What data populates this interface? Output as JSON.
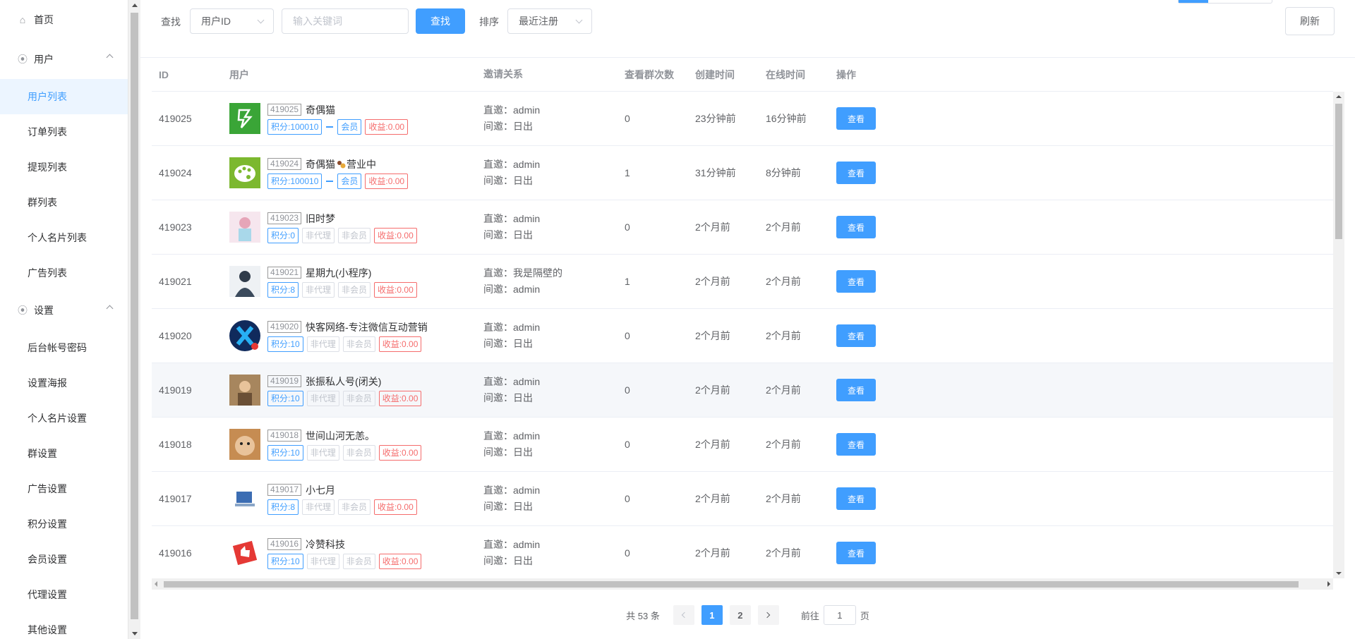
{
  "sidebar": {
    "home": {
      "label": "首页",
      "icon": "home-icon"
    },
    "groups": [
      {
        "label": "用户",
        "icon": "location-icon",
        "items": [
          {
            "label": "用户列表",
            "active": true
          },
          {
            "label": "订单列表"
          },
          {
            "label": "提现列表"
          },
          {
            "label": "群列表"
          },
          {
            "label": "个人名片列表"
          },
          {
            "label": "广告列表"
          }
        ]
      },
      {
        "label": "设置",
        "icon": "location-icon",
        "items": [
          {
            "label": "后台帐号密码"
          },
          {
            "label": "设置海报"
          },
          {
            "label": "个人名片设置"
          },
          {
            "label": "群设置"
          },
          {
            "label": "广告设置"
          },
          {
            "label": "积分设置"
          },
          {
            "label": "会员设置"
          },
          {
            "label": "代理设置"
          },
          {
            "label": "其他设置"
          }
        ]
      }
    ]
  },
  "toolbar": {
    "search_label": "查找",
    "field_select": "用户ID",
    "keyword_placeholder": "输入关键词",
    "search_button": "查找",
    "sort_label": "排序",
    "sort_select": "最近注册",
    "refresh_button": "刷新"
  },
  "table": {
    "headers": {
      "id": "ID",
      "user": "用户",
      "invite": "邀请关系",
      "views": "查看群次数",
      "created": "创建时间",
      "online": "在线时间",
      "ops": "操作"
    },
    "view_label": "查看",
    "rows": [
      {
        "id": "419025",
        "uid": "419025",
        "name": "奇偶猫",
        "status": "",
        "points": "积分:100010",
        "dash": true,
        "agent": "",
        "member": "会员",
        "member_active": true,
        "income": "收益:0.00",
        "direct": "直邀：admin",
        "indirect": "间邀：日出",
        "views": "0",
        "created": "23分钟前",
        "online": "16分钟前",
        "avatar": "green-bolt"
      },
      {
        "id": "419024",
        "uid": "419024",
        "name": "奇偶猫",
        "status": "营业中",
        "points": "积分:100010",
        "dash": true,
        "agent": "",
        "member": "会员",
        "member_active": true,
        "income": "收益:0.00",
        "direct": "直邀：admin",
        "indirect": "间邀：日出",
        "views": "1",
        "created": "31分钟前",
        "online": "8分钟前",
        "avatar": "green-palette"
      },
      {
        "id": "419023",
        "uid": "419023",
        "name": "旧时梦",
        "status": "",
        "points": "积分:0",
        "dash": false,
        "agent": "非代理",
        "member": "非会员",
        "member_active": false,
        "income": "收益:0.00",
        "direct": "直邀：admin",
        "indirect": "间邀：日出",
        "views": "0",
        "created": "2个月前",
        "online": "2个月前",
        "avatar": "pink-girl"
      },
      {
        "id": "419021",
        "uid": "419021",
        "name": "星期九(小程序)",
        "status": "",
        "points": "积分:8",
        "dash": false,
        "agent": "非代理",
        "member": "非会员",
        "member_active": false,
        "income": "收益:0.00",
        "direct": "直邀：我是隔壁的",
        "indirect": "间邀：admin",
        "views": "1",
        "created": "2个月前",
        "online": "2个月前",
        "avatar": "dark-figure"
      },
      {
        "id": "419020",
        "uid": "419020",
        "name": "快客网络-专注微信互动营销",
        "status": "",
        "points": "积分:10",
        "dash": false,
        "agent": "非代理",
        "member": "非会员",
        "member_active": false,
        "income": "收益:0.00",
        "direct": "直邀：admin",
        "indirect": "间邀：日出",
        "views": "0",
        "created": "2个月前",
        "online": "2个月前",
        "avatar": "blue-x"
      },
      {
        "id": "419019",
        "uid": "419019",
        "name": "张振私人号(闭关)",
        "status": "",
        "points": "积分:10",
        "dash": false,
        "agent": "非代理",
        "member": "非会员",
        "member_active": false,
        "income": "收益:0.00",
        "direct": "直邀：admin",
        "indirect": "间邀：日出",
        "views": "0",
        "created": "2个月前",
        "online": "2个月前",
        "avatar": "photo-man"
      },
      {
        "id": "419018",
        "uid": "419018",
        "name": "世间山河无恙。",
        "status": "",
        "points": "积分:10",
        "dash": false,
        "agent": "非代理",
        "member": "非会员",
        "member_active": false,
        "income": "收益:0.00",
        "direct": "直邀：admin",
        "indirect": "间邀：日出",
        "views": "0",
        "created": "2个月前",
        "online": "2个月前",
        "avatar": "cat"
      },
      {
        "id": "419017",
        "uid": "419017",
        "name": "小七月",
        "status": "",
        "points": "积分:8",
        "dash": false,
        "agent": "非代理",
        "member": "非会员",
        "member_active": false,
        "income": "收益:0.00",
        "direct": "直邀：admin",
        "indirect": "间邀：日出",
        "views": "0",
        "created": "2个月前",
        "online": "2个月前",
        "avatar": "computer"
      },
      {
        "id": "419016",
        "uid": "419016",
        "name": "冷赞科技",
        "status": "",
        "points": "积分:10",
        "dash": false,
        "agent": "非代理",
        "member": "非会员",
        "member_active": false,
        "income": "收益:0.00",
        "direct": "直邀：admin",
        "indirect": "间邀：日出",
        "views": "0",
        "created": "2个月前",
        "online": "2个月前",
        "avatar": "red-thumb"
      }
    ]
  },
  "pagination": {
    "total": "共 53 条",
    "pages": [
      "1",
      "2"
    ],
    "current": "1",
    "goto_label": "前往",
    "goto_value": "1",
    "page_suffix": "页"
  },
  "colors": {
    "primary": "#409eff",
    "danger": "#f56c6c",
    "active_bg": "#ecf5ff"
  }
}
